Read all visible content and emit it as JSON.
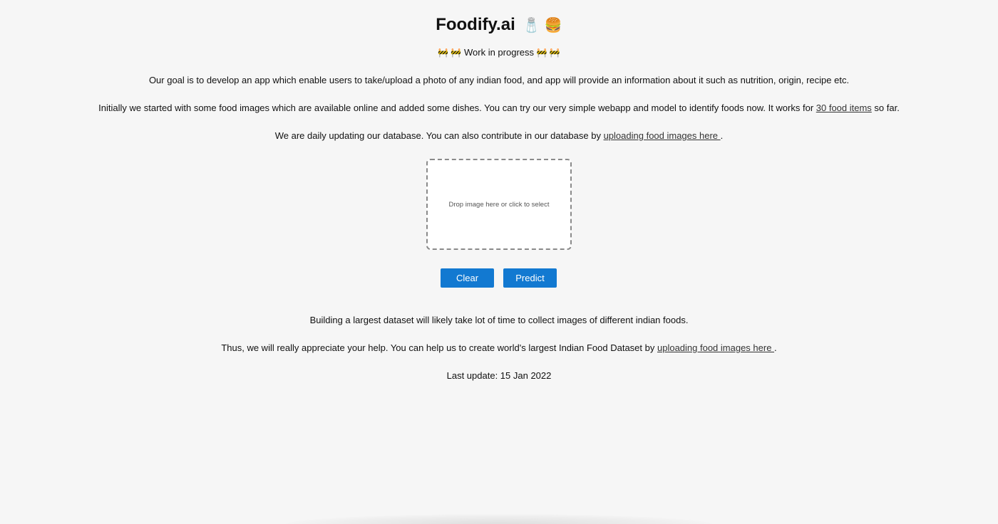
{
  "header": {
    "title": "Foodify.ai",
    "title_emoji": "🧂 🍔",
    "subtitle_emoji_left": "🚧 🚧",
    "subtitle": "Work in progress",
    "subtitle_emoji_right": "🚧 🚧"
  },
  "intro": {
    "goal": "Our goal is to develop an app which enable users to take/upload a photo of any indian food, and app will provide an information about it such as nutrition, origin, recipe etc.",
    "initial_before": "Initially we started with some food images which are available online and added some dishes. You can try our very simple webapp and model to identify foods now. It works for ",
    "initial_link": "30 food items",
    "initial_after": " so far.",
    "update_before": "We are daily updating our database. You can also contribute in our database by ",
    "update_link": "uploading food images here ",
    "update_after": "."
  },
  "uploader": {
    "dropzone_text": "Drop image here or click to select",
    "clear_label": "Clear",
    "predict_label": "Predict"
  },
  "footer": {
    "dataset_text": "Building a largest dataset will likely take lot of time to collect images of different indian foods.",
    "help_before": "Thus, we will really appreciate your help. You can help us to create world's largest Indian Food Dataset by ",
    "help_link": "uploading food images here ",
    "help_after": ".",
    "last_update": "Last update: 15 Jan 2022"
  },
  "colors": {
    "background": "#f6f6f6",
    "button": "#1279d1",
    "button_text": "#ffffff",
    "dropzone_border": "#8a8a8a"
  }
}
